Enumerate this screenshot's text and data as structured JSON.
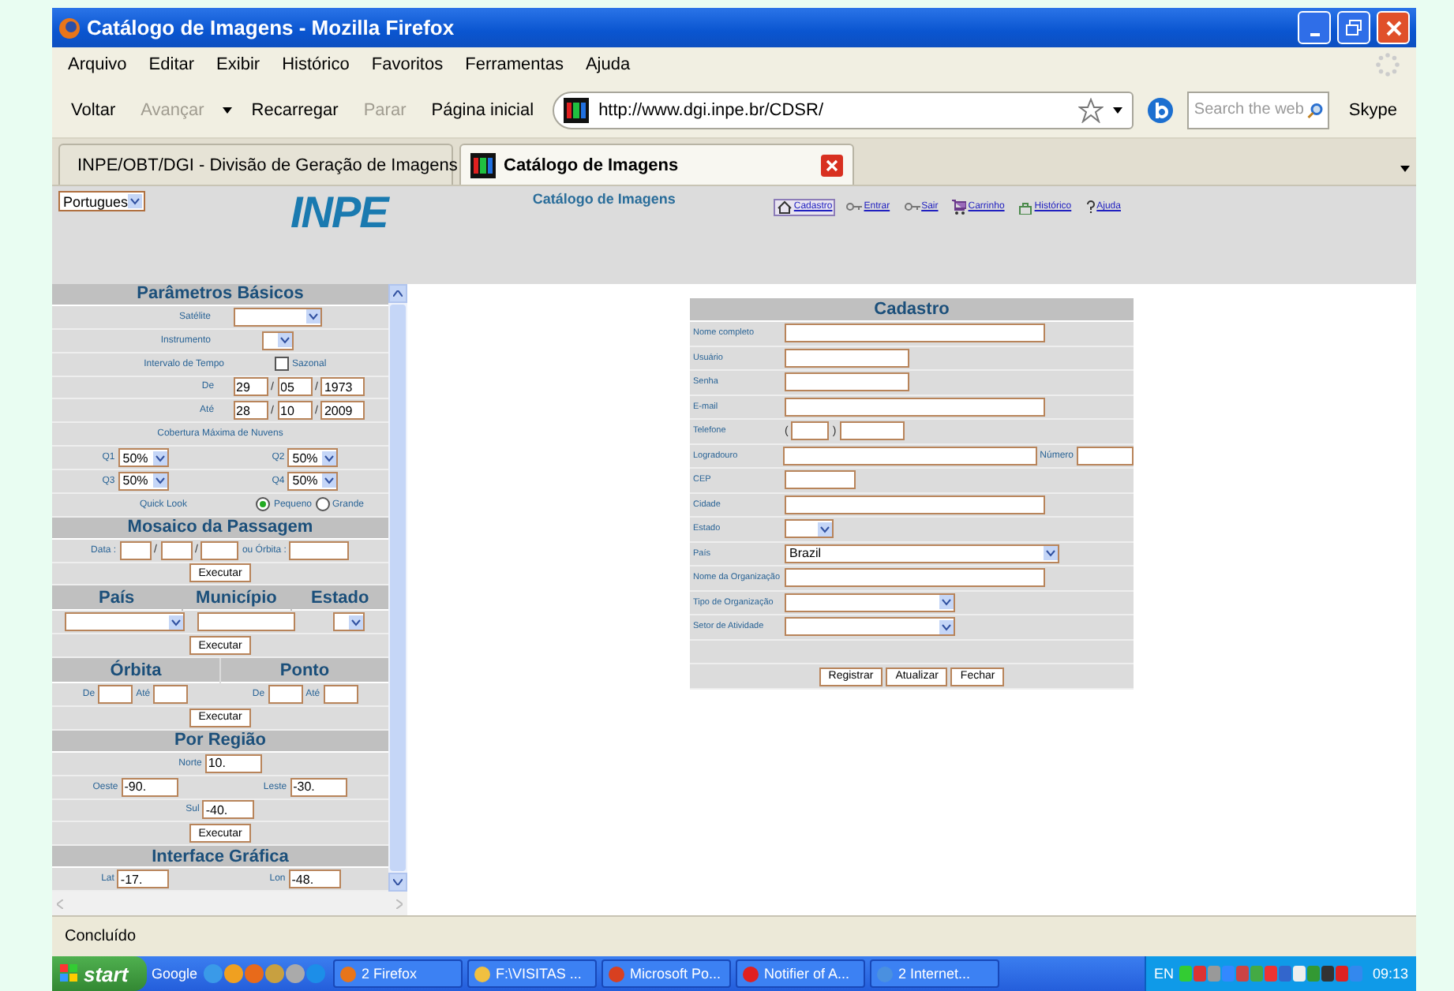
{
  "window": {
    "title": "Catálogo de Imagens - Mozilla Firefox"
  },
  "menu": [
    "Arquivo",
    "Editar",
    "Exibir",
    "Histórico",
    "Favoritos",
    "Ferramentas",
    "Ajuda"
  ],
  "toolbar": {
    "buttons": [
      {
        "label": "Voltar",
        "disabled": false
      },
      {
        "label": "Avançar",
        "disabled": true
      },
      {
        "label": "Recarregar",
        "disabled": false
      },
      {
        "label": "Parar",
        "disabled": true
      },
      {
        "label": "Página inicial",
        "disabled": false
      }
    ],
    "address": "http://www.dgi.inpe.br/CDSR/",
    "search_placeholder": "Search the web",
    "extra": "Skype"
  },
  "tabs": [
    {
      "label": "INPE/OBT/DGI - Divisão de Geração de Imagens",
      "selected": false
    },
    {
      "label": "Catálogo de Imagens",
      "selected": true
    }
  ],
  "page": {
    "language": "Portugues",
    "logo": "INPE",
    "heading": "Catálogo de Imagens",
    "nav": [
      {
        "label": "Cadastro",
        "kind": "house",
        "selected": true
      },
      {
        "label": "Entrar",
        "kind": "key",
        "selected": false
      },
      {
        "label": "Sair",
        "kind": "key",
        "selected": false
      },
      {
        "label": "Carrinho",
        "kind": "cart",
        "selected": false
      },
      {
        "label": "Histórico",
        "kind": "bag",
        "selected": false
      },
      {
        "label": "Ajuda",
        "kind": "help",
        "selected": false
      }
    ]
  },
  "basic": {
    "title": "Parâmetros Básicos",
    "satellite_label": "Satélite",
    "instrument_label": "Instrumento",
    "interval_label": "Intervalo de Tempo",
    "seasonal_label": "Sazonal",
    "seasonal_checked": false,
    "from": {
      "label": "De",
      "day": "29",
      "month": "05",
      "year": "1973",
      "separators": [
        "/",
        "/"
      ]
    },
    "to": {
      "label": "Até",
      "day": "28",
      "month": "10",
      "year": "2009",
      "separators": [
        "/",
        "/"
      ]
    },
    "cloud_label": "Cobertura Máxima de Nuvens",
    "quadrants": [
      {
        "label": "Q1",
        "value": "50%"
      },
      {
        "label": "Q2",
        "value": "50%"
      },
      {
        "label": "Q3",
        "value": "50%"
      },
      {
        "label": "Q4",
        "value": "50%"
      }
    ],
    "quicklook": {
      "label": "Quick Look",
      "options": [
        {
          "label": "Pequeno",
          "selected": true
        },
        {
          "label": "Grande",
          "selected": false
        }
      ]
    }
  },
  "mosaic": {
    "title": "Mosaico da Passagem",
    "date_label": "Data :",
    "separators": [
      "/",
      "/"
    ],
    "orbit_label": "ou  Órbita :",
    "button": "Executar"
  },
  "location": {
    "headers": [
      "País",
      "Município",
      "Estado"
    ],
    "button": "Executar"
  },
  "orbit_point": {
    "headers": [
      "Órbita",
      "Ponto"
    ],
    "groups": [
      {
        "from_label": "De",
        "to_label": "Até"
      },
      {
        "from_label": "De",
        "to_label": "Até"
      }
    ],
    "button": "Executar"
  },
  "region": {
    "title": "Por Região",
    "north": {
      "label": "Norte",
      "value": "10."
    },
    "west": {
      "label": "Oeste",
      "value": "-90."
    },
    "east": {
      "label": "Leste",
      "value": "-30."
    },
    "south": {
      "label": "Sul",
      "value": "-40."
    },
    "button": "Executar"
  },
  "graphic": {
    "title": "Interface Gráfica",
    "lat": {
      "label": "Lat",
      "value": "-17."
    },
    "lon": {
      "label": "Lon",
      "value": "-48."
    }
  },
  "form": {
    "title": "Cadastro",
    "fields": [
      {
        "label": "Nome completo",
        "kind": "long"
      },
      {
        "label": "Usuário",
        "kind": "short"
      },
      {
        "label": "Senha",
        "kind": "short"
      },
      {
        "label": "E-mail",
        "kind": "long"
      },
      {
        "label": "Telefone",
        "kind": "phone",
        "open": "(",
        "close": ")"
      },
      {
        "label": "Logradouro",
        "kind": "street",
        "extra_label": "Número"
      },
      {
        "label": "CEP",
        "kind": "tiny"
      },
      {
        "label": "Cidade",
        "kind": "long"
      },
      {
        "label": "Estado",
        "kind": "select_small"
      },
      {
        "label": "País",
        "kind": "select_wide",
        "value": "Brazil"
      },
      {
        "label": "Nome da Organização",
        "kind": "long"
      },
      {
        "label": "Tipo de Organização",
        "kind": "select"
      },
      {
        "label": "Setor de Atividade",
        "kind": "select"
      }
    ],
    "buttons": [
      "Registrar",
      "Atualizar",
      "Fechar"
    ]
  },
  "status": "Concluído",
  "taskbar": {
    "start": "start",
    "toolbar": "Google",
    "tasks": [
      "2 Firefox",
      "F:\\VISITAS ...",
      "Microsoft Po...",
      "Notifier of A...",
      "2 Internet..."
    ],
    "language": "EN",
    "clock": "09:13"
  }
}
